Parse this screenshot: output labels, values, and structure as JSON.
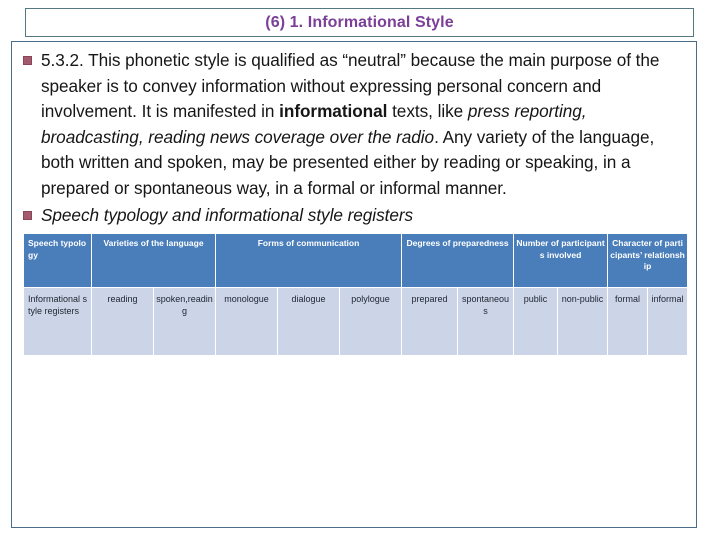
{
  "slide": {
    "title": "(6) 1. Informational Style",
    "title_color": "#7b3f98",
    "accent_header_color": "#4a7ebb",
    "table_row_color": "#ccd5e8",
    "bullet_color": "#a35a6e",
    "border_color": "#4a6d8c"
  },
  "body": {
    "paragraph": {
      "part1": "5.3.2. This phonetic style is qualified as “neutral” because the main purpose of the speaker is to convey information without expressing personal concern and involvement. It is manifested in ",
      "bold1": "informational",
      "part2": " texts, like ",
      "italic1": "press reporting, broadcasting, reading news coverage over the radio",
      "part3": ". Any variety of the language, both written and spoken, may be presented either by reading or speaking, in a prepared or spontaneous way, in a formal or informal manner."
    },
    "subheading": "Speech typology and informational style registers"
  },
  "table": {
    "headers": [
      {
        "label": "Speech typology",
        "span": 1
      },
      {
        "label": "Varieties of the language",
        "span": 2
      },
      {
        "label": "Forms of communication",
        "span": 3
      },
      {
        "label": "Degrees of preparedness",
        "span": 2
      },
      {
        "label": "Number of participants involved",
        "span": 2
      },
      {
        "label": "Character of participants’ relationship",
        "span": 2
      }
    ],
    "rows": [
      {
        "cells": [
          "Informational style registers",
          "reading",
          "spoken,reading",
          "monologue",
          "dialogue",
          "polylogue",
          "prepared",
          "spontaneous",
          "public",
          "non-public",
          "formal",
          "informal"
        ]
      }
    ]
  }
}
